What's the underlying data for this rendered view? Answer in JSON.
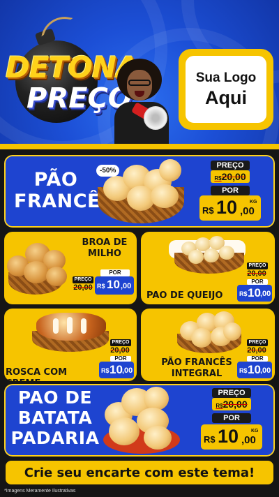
{
  "header": {
    "title_line1": "DETONA",
    "title_line2": "PREÇO",
    "logo_line1": "Sua Logo",
    "logo_line2": "Aqui"
  },
  "price_labels": {
    "preco": "PREÇO",
    "por": "POR",
    "currency": "R$",
    "kg": "KG"
  },
  "products": [
    {
      "name_line1": "PÃO",
      "name_line2": "FRANCÊS",
      "old_price": "20,00",
      "new_int": "10",
      "new_dec": ",00",
      "discount": "-50%"
    },
    {
      "name_line1": "BROA DE",
      "name_line2": "MILHO",
      "old_price": "20,00",
      "new_int": "10",
      "new_dec": ",00"
    },
    {
      "name_line1": "PAO DE QUEIJO",
      "old_price": "20,00",
      "new_int": "10",
      "new_dec": ",00"
    },
    {
      "name_line1": "ROSCA COM CREME",
      "old_price": "20,00",
      "new_int": "10",
      "new_dec": ",00"
    },
    {
      "name_line1": "PÃO FRANCÊS",
      "name_line2": "INTEGRAL",
      "old_price": "20,00",
      "new_int": "10",
      "new_dec": ",00"
    },
    {
      "name_line1": "PAO DE",
      "name_line2": "BATATA",
      "name_line3": "PADARIA",
      "old_price": "20,00",
      "new_int": "10",
      "new_dec": ",00"
    }
  ],
  "footer": {
    "cta": "Crie seu encarte com este tema!",
    "disclaimer": "*Imagens Meramente Ilustrativas"
  },
  "colors": {
    "brand_blue": "#1e44d0",
    "brand_yellow": "#f6c400",
    "dark": "#151515"
  }
}
